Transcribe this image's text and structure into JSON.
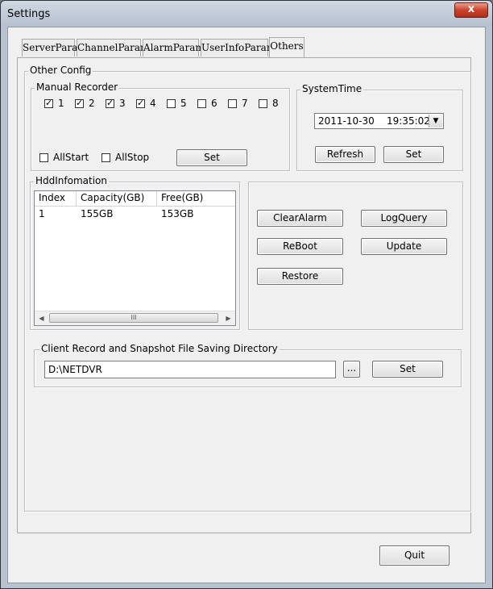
{
  "window": {
    "title": "Settings",
    "close_label": "x"
  },
  "tabs": [
    "ServerParam",
    "ChannelParam",
    "AlarmParam",
    "UserInfoParam",
    "Others"
  ],
  "active_tab": "Others",
  "other_config": {
    "label": "Other Config",
    "manual_recorder": {
      "label": "Manual Recorder",
      "channels": [
        {
          "label": "1",
          "checked": true
        },
        {
          "label": "2",
          "checked": true
        },
        {
          "label": "3",
          "checked": true
        },
        {
          "label": "4",
          "checked": true
        },
        {
          "label": "5",
          "checked": false
        },
        {
          "label": "6",
          "checked": false
        },
        {
          "label": "7",
          "checked": false
        },
        {
          "label": "8",
          "checked": false
        }
      ],
      "all_start_label": "AllStart",
      "all_stop_label": "AllStop",
      "set_label": "Set"
    },
    "system_time": {
      "label": "SystemTime",
      "value": "2011-10-30    19:35:02",
      "refresh_label": "Refresh",
      "set_label": "Set"
    },
    "hdd_info": {
      "label": "HddInfomation",
      "columns": [
        "Index",
        "Capacity(GB)",
        "Free(GB)"
      ],
      "rows": [
        [
          "1",
          "155GB",
          "153GB"
        ]
      ],
      "scroll_thumb_glyph": "III"
    },
    "actions": {
      "clear_alarm_label": "ClearAlarm",
      "log_query_label": "LogQuery",
      "reboot_label": "ReBoot",
      "update_label": "Update",
      "restore_label": "Restore"
    },
    "directory": {
      "label": "Client Record and Snapshot File Saving Directory",
      "value": "D:\\NETDVR",
      "browse_label": "...",
      "set_label": "Set"
    }
  },
  "quit_label": "Quit"
}
